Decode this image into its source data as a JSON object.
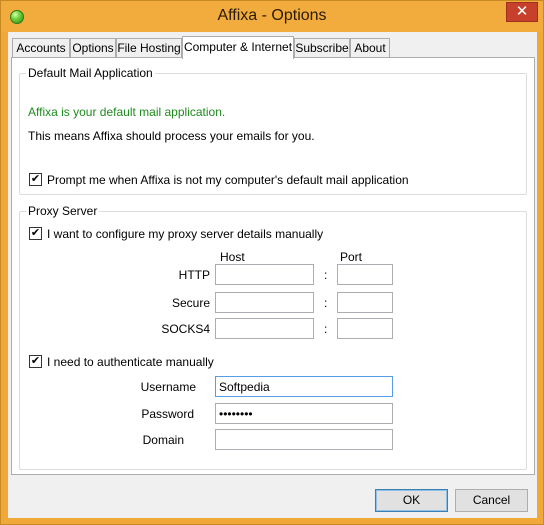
{
  "window": {
    "title": "Affixa - Options",
    "close_label": "✕"
  },
  "tabs": [
    "Accounts",
    "Options",
    "File Hosting",
    "Computer & Internet",
    "Subscribe",
    "About"
  ],
  "active_tab": "Computer & Internet",
  "mail": {
    "legend": "Default Mail Application",
    "status": "Affixa is your default mail application.",
    "info": "This means Affixa should process your emails for you.",
    "prompt_label": "Prompt me when Affixa is not my computer's default mail application",
    "prompt_checked": true
  },
  "proxy": {
    "legend": "Proxy Server",
    "manual_label": "I want to configure my proxy server details manually",
    "manual_checked": true,
    "host_header": "Host",
    "port_header": "Port",
    "separator": ":",
    "rows": [
      {
        "label": "HTTP",
        "host": "",
        "port": ""
      },
      {
        "label": "Secure",
        "host": "",
        "port": ""
      },
      {
        "label": "SOCKS4",
        "host": "",
        "port": ""
      }
    ],
    "auth_label": "I need to authenticate manually",
    "auth_checked": true,
    "username_label": "Username",
    "username_value": "Softpedia",
    "password_label": "Password",
    "password_value": "••••••••",
    "domain_label": "Domain",
    "domain_value": ""
  },
  "buttons": {
    "ok": "OK",
    "cancel": "Cancel"
  },
  "colors": {
    "title_bar": "#f2ac3e",
    "status_green": "#1e8a1e",
    "focus_border": "#569de5"
  }
}
